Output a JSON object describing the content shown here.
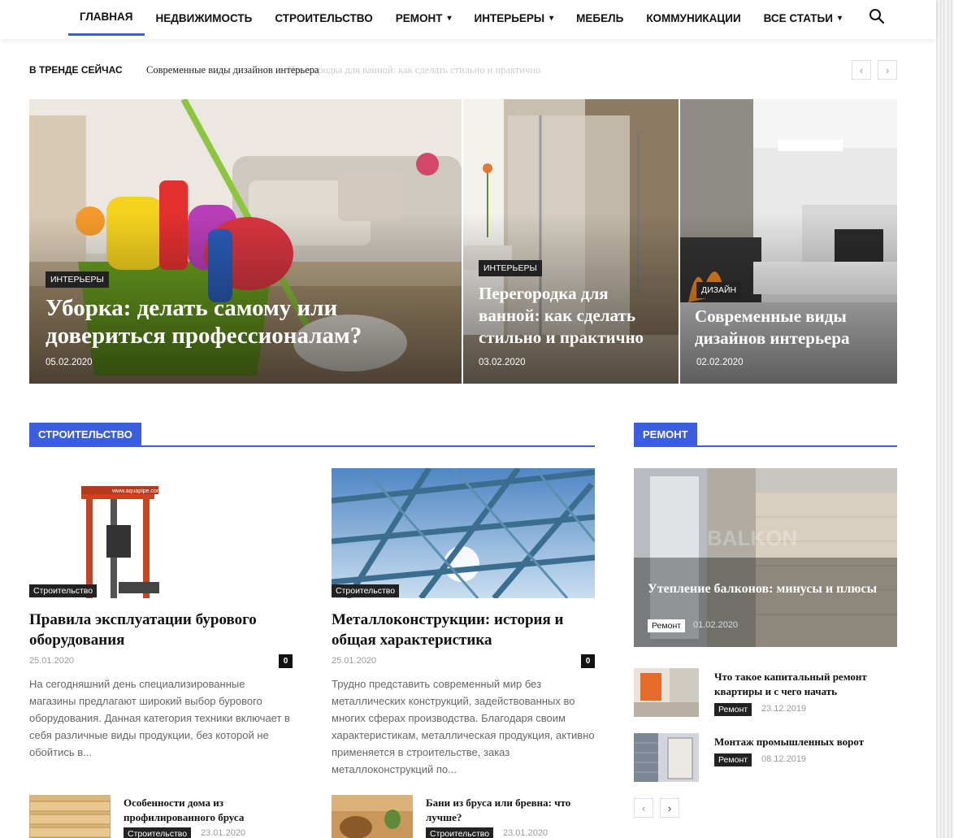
{
  "nav": {
    "items": [
      {
        "label": "ГЛАВНАЯ",
        "active": true,
        "dropdown": false
      },
      {
        "label": "НЕДВИЖИМОСТЬ",
        "active": false,
        "dropdown": false
      },
      {
        "label": "СТРОИТЕЛЬСТВО",
        "active": false,
        "dropdown": false
      },
      {
        "label": "РЕМОНТ",
        "active": false,
        "dropdown": true
      },
      {
        "label": "ИНТЕРЬЕРЫ",
        "active": false,
        "dropdown": true
      },
      {
        "label": "МЕБЕЛЬ",
        "active": false,
        "dropdown": false
      },
      {
        "label": "КОММУНИКАЦИИ",
        "active": false,
        "dropdown": false
      },
      {
        "label": "ВСЕ СТАТЬИ",
        "active": false,
        "dropdown": true
      }
    ],
    "chevron": "▾",
    "search_icon": "search-icon"
  },
  "trending": {
    "label": "В ТРЕНДЕ СЕЙЧАС",
    "current": "Современные виды дизайнов интерьера",
    "ghost": "Перегородка для ванной: как сделать стильно и практично",
    "prev": "‹",
    "next": "›"
  },
  "hero": [
    {
      "category": "ИНТЕРЬЕРЫ",
      "title": "Уборка: делать самому или довериться профессионалам?",
      "date": "05.02.2020"
    },
    {
      "category": "ИНТЕРЬЕРЫ",
      "title": "Перегородка для ванной: как сделать стильно и практично",
      "date": "03.02.2020"
    },
    {
      "category": "ДИЗАЙН",
      "title": "Современные виды дизайнов интерьера",
      "date": "02.02.2020"
    }
  ],
  "stroitelstvo": {
    "header": "СТРОИТЕЛЬСТВО",
    "cards": [
      {
        "category": "Строительство",
        "title": "Правила эксплуатации бурового оборудования",
        "date": "25.01.2020",
        "comments": "0",
        "excerpt": "На сегодняшний день специализированные магазины предлагают широкий выбор бурового оборудования. Данная категория техники включает в себя различные виды продукции, без которой не обойтись в...",
        "img_text": "www.aquapipe.com.ua"
      },
      {
        "category": "Строительство",
        "title": "Металлоконструкции: история и общая характеристика",
        "date": "25.01.2020",
        "comments": "0",
        "excerpt": "Трудно представить современный мир без металлических конструкций, задействованных во многих сферах производства. Благодаря своим характеристикам, металлическая продукция, активно применяется в строительстве, заказ металлоконструкций по..."
      }
    ],
    "mini": [
      {
        "title": "Особенности дома из профилированного бруса",
        "category": "Строительство",
        "date": "23.01.2020"
      },
      {
        "title": "Бани из бруса или бревна: что лучше?",
        "category": "Строительство",
        "date": "23.01.2020"
      }
    ]
  },
  "remont": {
    "header": "РЕМОНТ",
    "featured": {
      "title": "Утепление балконов: минусы и плюсы",
      "category": "Ремонт",
      "date": "01.02.2020",
      "watermark": "BALKON"
    },
    "list": [
      {
        "title": "Что такое капитальный ремонт квартиры и с чего начать",
        "category": "Ремонт",
        "date": "23.12.2019"
      },
      {
        "title": "Монтаж промышленных ворот",
        "category": "Ремонт",
        "date": "08.12.2019"
      }
    ],
    "prev": "‹",
    "next": "›"
  },
  "colors": {
    "accent": "#3b5ee0",
    "badge": "#222222"
  }
}
